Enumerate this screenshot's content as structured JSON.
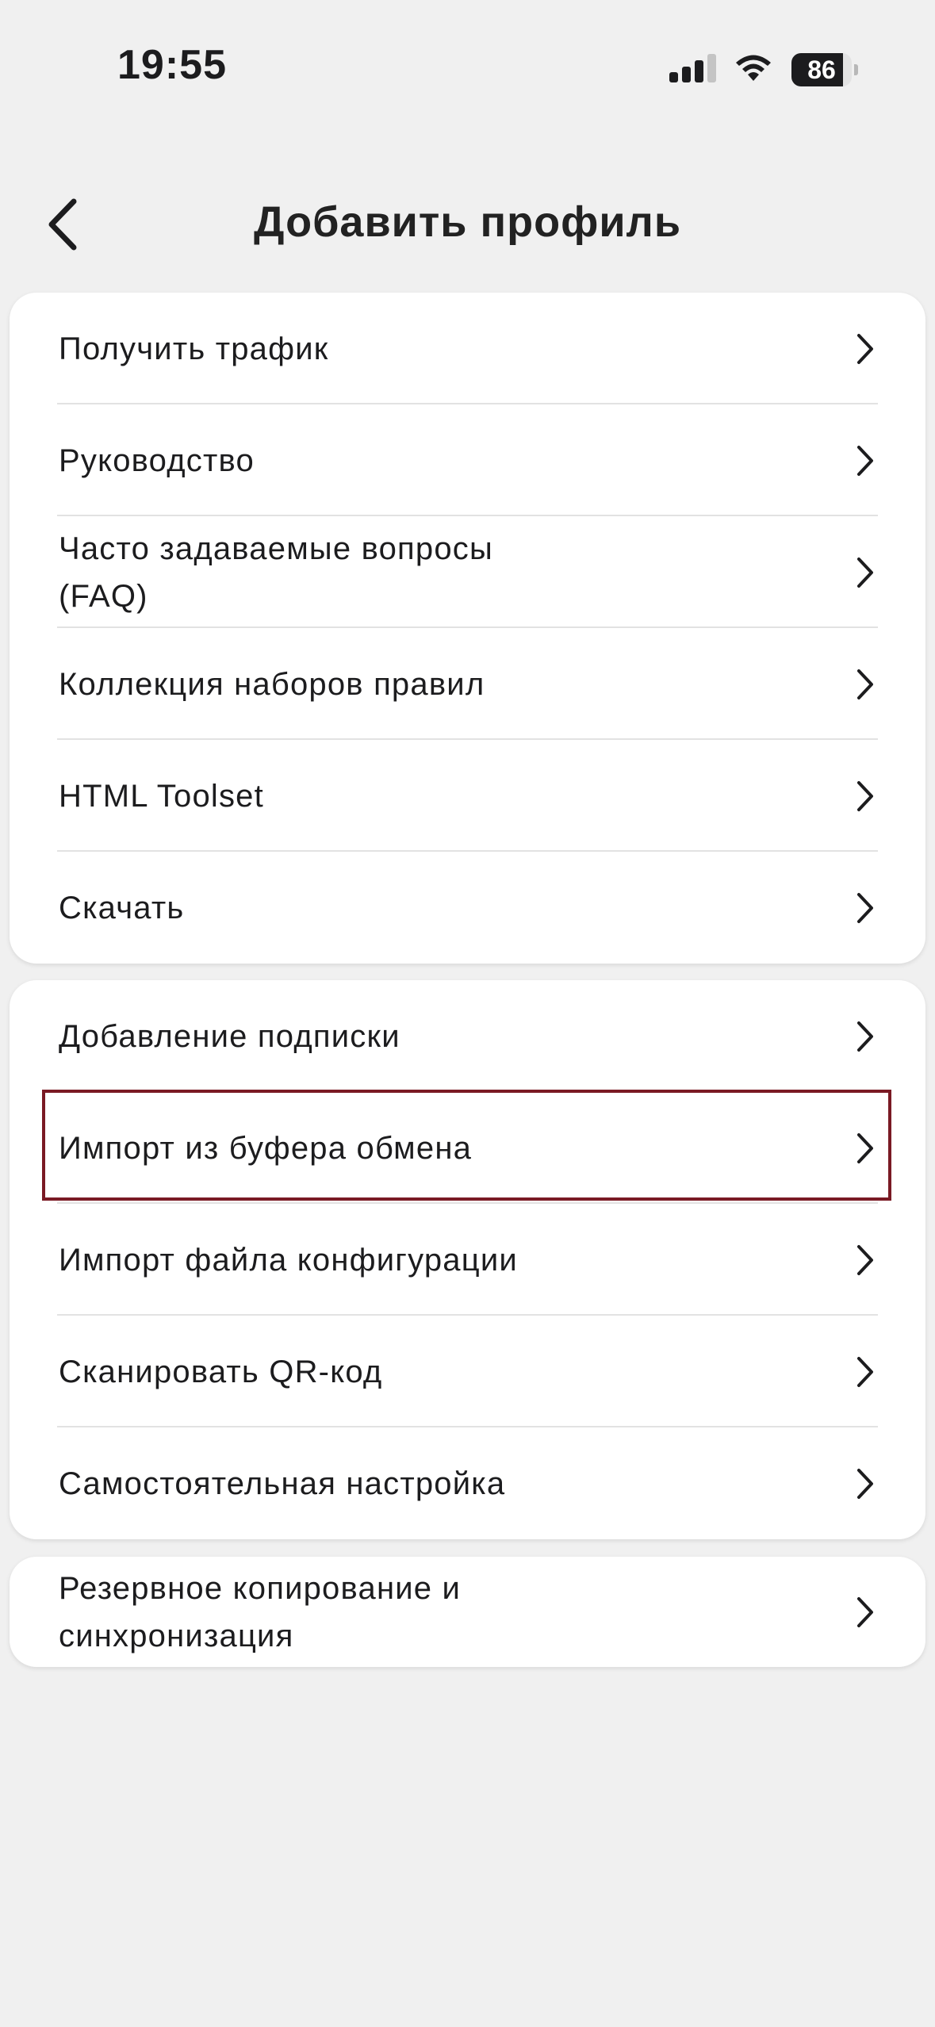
{
  "status_bar": {
    "time": "19:55",
    "battery_level": "86",
    "battery_fraction": 0.86,
    "icons": [
      "signal-icon",
      "wifi-icon",
      "battery-icon"
    ]
  },
  "header": {
    "title": "Добавить профиль",
    "back_icon": "chevron-left-icon"
  },
  "groups": [
    {
      "items": [
        {
          "label": "Получить трафик"
        },
        {
          "label": "Руководство"
        },
        {
          "label": "Часто задаваемые вопросы\n(FAQ)"
        },
        {
          "label": "Коллекция наборов правил"
        },
        {
          "label": "HTML Toolset"
        },
        {
          "label": "Скачать"
        }
      ]
    },
    {
      "items": [
        {
          "label": "Добавление подписки"
        },
        {
          "label": "Импорт из буфера обмена"
        },
        {
          "label": "Импорт файла конфигурации"
        },
        {
          "label": "Сканировать QR-код"
        },
        {
          "label": "Самостоятельная настройка"
        }
      ]
    },
    {
      "items": [
        {
          "label": "Резервное копирование и\nсинхронизация"
        }
      ]
    }
  ],
  "colors": {
    "background": "#f0f0f0",
    "card": "#ffffff",
    "text": "#1c1c1e",
    "divider": "#e2e2e2",
    "highlight_border": "#7a1a24"
  }
}
